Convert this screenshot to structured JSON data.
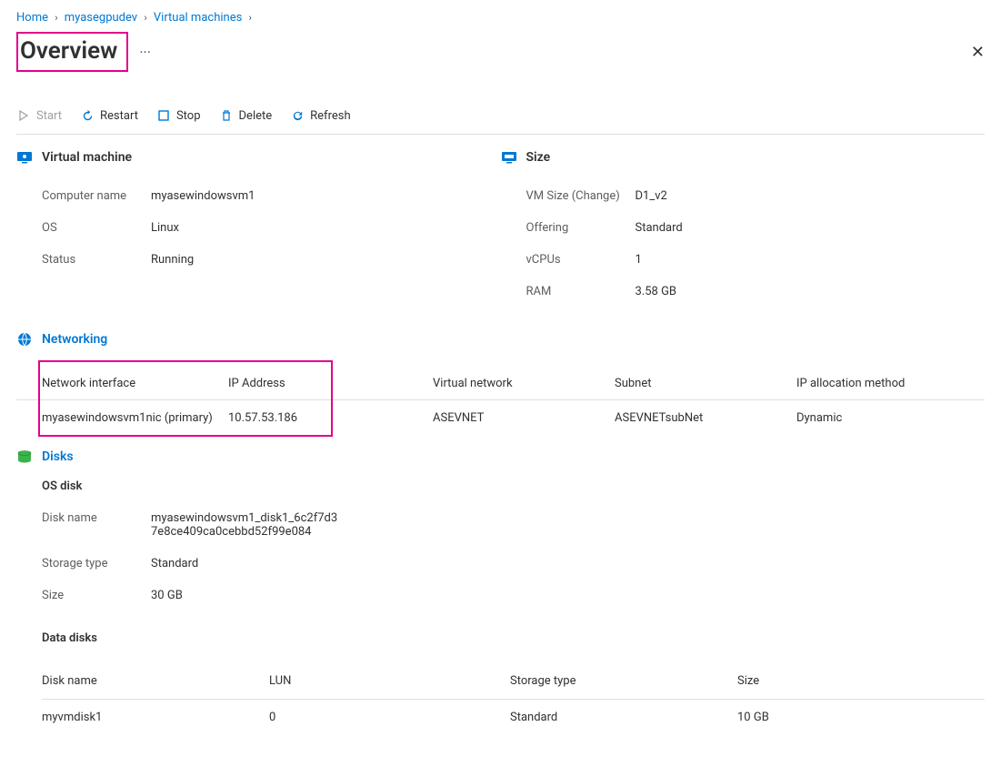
{
  "breadcrumb": {
    "home": "Home",
    "resource": "myasegpudev",
    "vms": "Virtual machines"
  },
  "page_title": "Overview",
  "toolbar": {
    "start": "Start",
    "restart": "Restart",
    "stop": "Stop",
    "delete": "Delete",
    "refresh": "Refresh"
  },
  "vm": {
    "section_title": "Virtual machine",
    "computer_name_label": "Computer name",
    "computer_name": "myasewindowsvm1",
    "os_label": "OS",
    "os": "Linux",
    "status_label": "Status",
    "status": "Running"
  },
  "size": {
    "section_title": "Size",
    "vm_size_label": "VM Size",
    "change_link": "Change",
    "vm_size": "D1_v2",
    "offering_label": "Offering",
    "offering": "Standard",
    "vcpus_label": "vCPUs",
    "vcpus": "1",
    "ram_label": "RAM",
    "ram": "3.58 GB"
  },
  "networking": {
    "section_title": "Networking",
    "columns": {
      "nic": "Network interface",
      "ip": "IP Address",
      "vnet": "Virtual network",
      "subnet": "Subnet",
      "alloc": "IP allocation method"
    },
    "row": {
      "nic": "myasewindowsvm1nic (primary)",
      "ip": "10.57.53.186",
      "vnet": "ASEVNET",
      "subnet": "ASEVNETsubNet",
      "alloc": "Dynamic"
    }
  },
  "disks": {
    "section_title": "Disks",
    "os_disk_title": "OS disk",
    "disk_name_label": "Disk name",
    "disk_name": "myasewindowsvm1_disk1_6c2f7d37e8ce409ca0cebbd52f99e084",
    "storage_type_label": "Storage type",
    "storage_type": "Standard",
    "size_label": "Size",
    "size": "30 GB",
    "data_disks_title": "Data disks",
    "columns": {
      "name": "Disk name",
      "lun": "LUN",
      "storage": "Storage type",
      "size": "Size"
    },
    "row": {
      "name": "myvmdisk1",
      "lun": "0",
      "storage": "Standard",
      "size": "10 GB"
    }
  }
}
